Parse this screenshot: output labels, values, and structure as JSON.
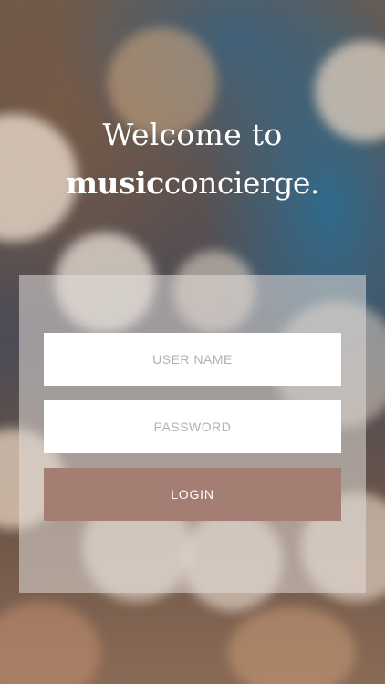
{
  "background": {
    "description_colors": [
      "#6f5a4a",
      "#2e6e96",
      "#8b6b56"
    ]
  },
  "header": {
    "welcome_text": "Welcome to",
    "brand_bold": "music",
    "brand_light": "concierge."
  },
  "form": {
    "username_placeholder": "USER NAME",
    "password_placeholder": "PASSWORD",
    "login_label": "LOGIN"
  },
  "colors": {
    "login_button": "#a47e72",
    "panel": "rgba(225,220,216,0.55)",
    "text": "#ffffff"
  }
}
